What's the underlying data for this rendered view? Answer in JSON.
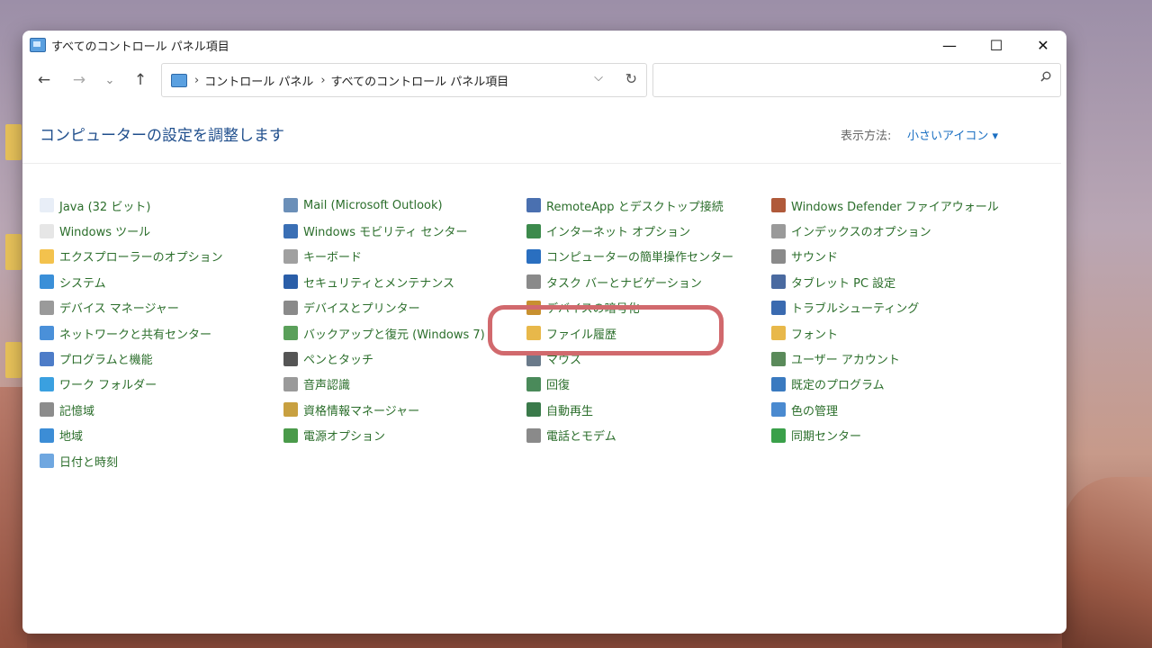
{
  "window": {
    "title": "すべてのコントロール パネル項目",
    "controls": {
      "minimize": "—",
      "maximize": "☐",
      "close": "✕"
    }
  },
  "nav": {
    "back": "←",
    "forward": "→",
    "recent": "⌄",
    "up": "↑",
    "breadcrumb": [
      "コントロール パネル",
      "すべてのコントロール パネル項目"
    ],
    "separator": "›",
    "search_placeholder": ""
  },
  "header": {
    "title": "コンピューターの設定を調整します",
    "view_label": "表示方法:",
    "view_value": "小さいアイコン ▾"
  },
  "columns": [
    [
      {
        "label": "Java (32 ビット)",
        "icon": "java-icon",
        "color": "#e8eef7"
      },
      {
        "label": "Windows ツール",
        "icon": "gear-icon",
        "color": "#e6e6e6"
      },
      {
        "label": "エクスプローラーのオプション",
        "icon": "folder-options-icon",
        "color": "#f3c24d"
      },
      {
        "label": "システム",
        "icon": "monitor-icon",
        "color": "#3a8fd8"
      },
      {
        "label": "デバイス マネージャー",
        "icon": "printer-icon",
        "color": "#9a9a9a"
      },
      {
        "label": "ネットワークと共有センター",
        "icon": "network-icon",
        "color": "#4a90d9"
      },
      {
        "label": "プログラムと機能",
        "icon": "programs-icon",
        "color": "#4d7cc8"
      },
      {
        "label": "ワーク フォルダー",
        "icon": "work-folder-icon",
        "color": "#3aa0e0"
      },
      {
        "label": "記憶域",
        "icon": "storage-icon",
        "color": "#8c8c8c"
      },
      {
        "label": "地域",
        "icon": "globe-icon",
        "color": "#3c8dd6"
      },
      {
        "label": "日付と時刻",
        "icon": "calendar-icon",
        "color": "#6fa7e0"
      }
    ],
    [
      {
        "label": "Mail (Microsoft Outlook)",
        "icon": "mail-icon",
        "color": "#6b8fb8"
      },
      {
        "label": "Windows モビリティ センター",
        "icon": "mobility-icon",
        "color": "#3a6fb5"
      },
      {
        "label": "キーボード",
        "icon": "keyboard-icon",
        "color": "#a0a0a0"
      },
      {
        "label": "セキュリティとメンテナンス",
        "icon": "flag-icon",
        "color": "#2a5ea8"
      },
      {
        "label": "デバイスとプリンター",
        "icon": "devices-icon",
        "color": "#8a8a8a"
      },
      {
        "label": "バックアップと復元 (Windows 7)",
        "icon": "backup-icon",
        "color": "#5aa05a"
      },
      {
        "label": "ペンとタッチ",
        "icon": "pen-icon",
        "color": "#555555"
      },
      {
        "label": "音声認識",
        "icon": "microphone-icon",
        "color": "#9a9a9a"
      },
      {
        "label": "資格情報マネージャー",
        "icon": "credential-icon",
        "color": "#c8a040"
      },
      {
        "label": "電源オプション",
        "icon": "power-icon",
        "color": "#4a9a4a"
      }
    ],
    [
      {
        "label": "RemoteApp とデスクトップ接続",
        "icon": "remoteapp-icon",
        "color": "#4a70b0"
      },
      {
        "label": "インターネット オプション",
        "icon": "internet-icon",
        "color": "#3c8a4c"
      },
      {
        "label": "コンピューターの簡単操作センター",
        "icon": "ease-access-icon",
        "color": "#2a6fc0"
      },
      {
        "label": "タスク バーとナビゲーション",
        "icon": "taskbar-icon",
        "color": "#8a8a8a"
      },
      {
        "label": "デバイスの暗号化",
        "icon": "key-icon",
        "color": "#c89030"
      },
      {
        "label": "ファイル履歴",
        "icon": "file-history-icon",
        "color": "#e8b84a"
      },
      {
        "label": "マウス",
        "icon": "mouse-icon",
        "color": "#6a7a8a"
      },
      {
        "label": "回復",
        "icon": "recovery-icon",
        "color": "#4a8a5a"
      },
      {
        "label": "自動再生",
        "icon": "autoplay-icon",
        "color": "#3a7a4a"
      },
      {
        "label": "電話とモデム",
        "icon": "phone-icon",
        "color": "#8a8a8a"
      }
    ],
    [
      {
        "label": "Windows Defender ファイアウォール",
        "icon": "firewall-icon",
        "color": "#b05a3a"
      },
      {
        "label": "インデックスのオプション",
        "icon": "indexing-icon",
        "color": "#9a9a9a"
      },
      {
        "label": "サウンド",
        "icon": "sound-icon",
        "color": "#8a8a8a"
      },
      {
        "label": "タブレット PC 設定",
        "icon": "tablet-icon",
        "color": "#4a6aa0"
      },
      {
        "label": "トラブルシューティング",
        "icon": "troubleshoot-icon",
        "color": "#3a6ab0"
      },
      {
        "label": "フォント",
        "icon": "font-icon",
        "color": "#e8b84a"
      },
      {
        "label": "ユーザー アカウント",
        "icon": "users-icon",
        "color": "#5a8a5a"
      },
      {
        "label": "既定のプログラム",
        "icon": "default-programs-icon",
        "color": "#3a7ac0"
      },
      {
        "label": "色の管理",
        "icon": "color-management-icon",
        "color": "#4a8ad0"
      },
      {
        "label": "同期センター",
        "icon": "sync-icon",
        "color": "#3aa04a"
      }
    ]
  ],
  "colors": {
    "link": "#2b6e2b",
    "title": "#1f4e8c",
    "highlight": "#d1696d"
  }
}
